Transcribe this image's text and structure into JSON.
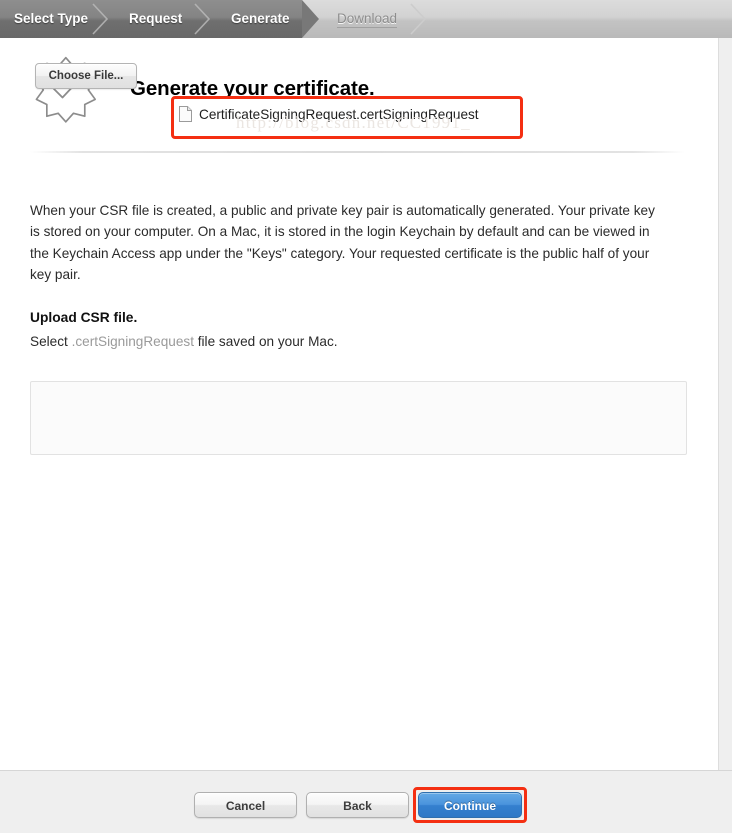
{
  "stepbar": {
    "steps": [
      {
        "label": "Select Type",
        "state": "done"
      },
      {
        "label": "Request",
        "state": "done"
      },
      {
        "label": "Generate",
        "state": "current"
      },
      {
        "label": "Download",
        "state": "upcoming"
      }
    ]
  },
  "header": {
    "title": "Generate your certificate.",
    "icon": "certificate-badge-check-icon"
  },
  "main": {
    "paragraph": "When your CSR file is created, a public and private key pair is automatically generated. Your private key is stored on your computer. On a Mac, it is stored in the login Keychain by default and can be viewed in the Keychain Access app under the \"Keys\" category. Your requested certificate is the public half of your key pair.",
    "section_heading": "Upload CSR file.",
    "instruction_prefix": "Select ",
    "instruction_extension": ".certSigningRequest",
    "instruction_suffix": " file saved on your Mac."
  },
  "upload": {
    "choose_file_label": "Choose File...",
    "selected_file_name": "CertificateSigningRequest.certSigningRequest",
    "file_icon": "document-icon",
    "watermark_text": "http://blog.csdn.net/CC1991_"
  },
  "footer": {
    "cancel_label": "Cancel",
    "back_label": "Back",
    "continue_label": "Continue"
  },
  "colors": {
    "accent_blue": "#3480cf",
    "highlight_red": "#f42f12",
    "stepbar_active": "#787878",
    "stepbar_inactive": "#c3c3c3",
    "muted_text": "#9a9a9a"
  }
}
